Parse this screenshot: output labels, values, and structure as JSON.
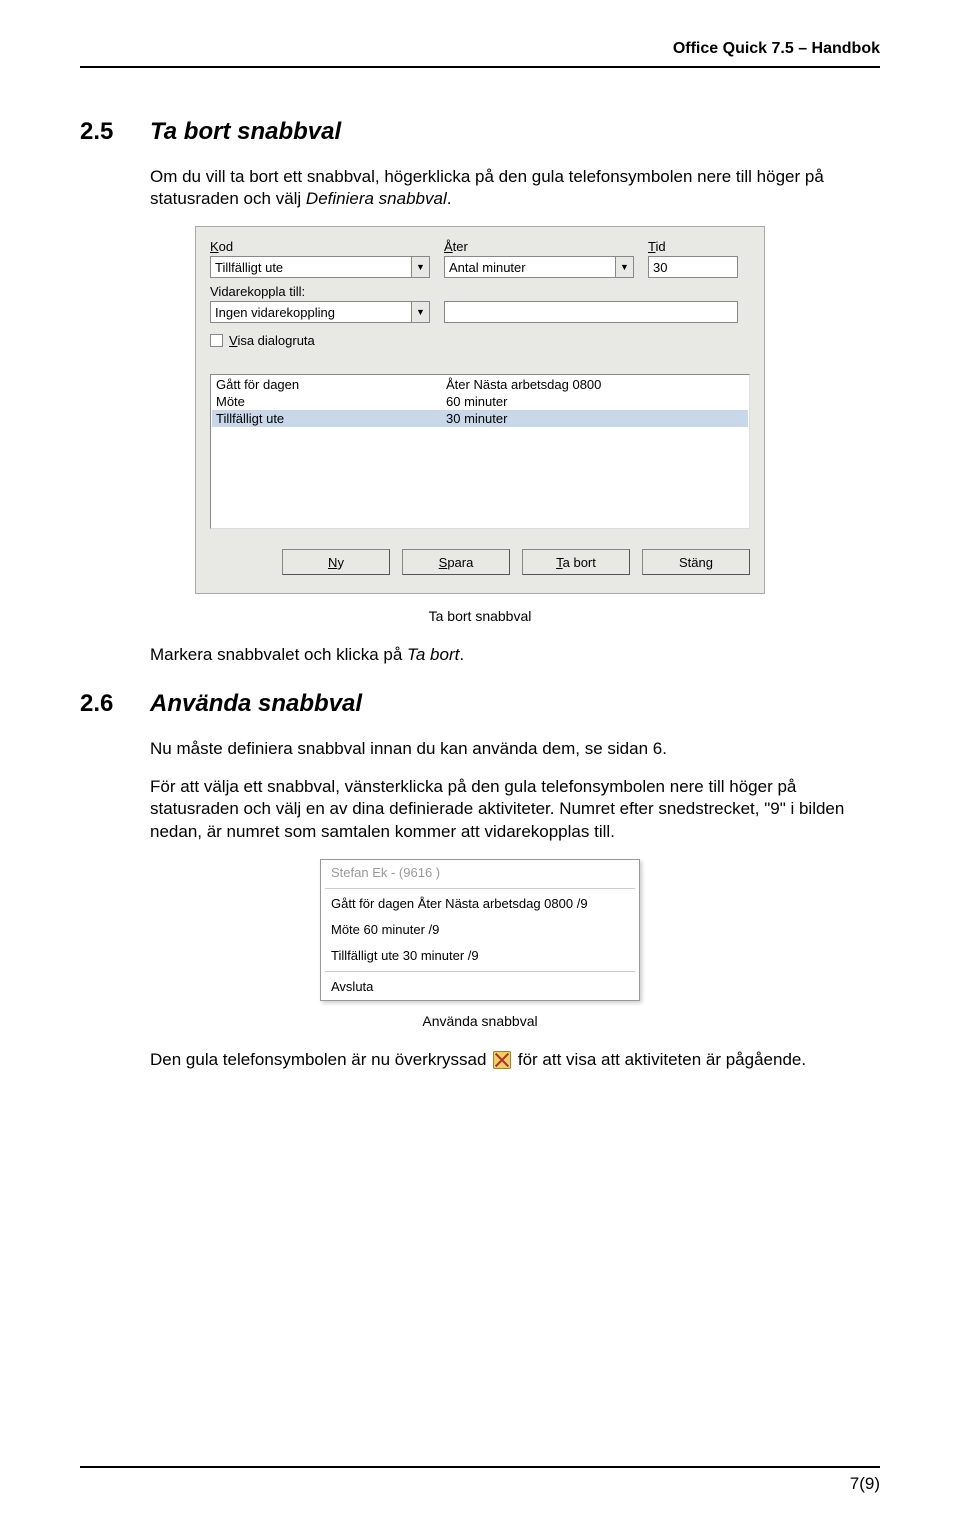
{
  "header": {
    "title": "Office Quick 7.5 – Handbok"
  },
  "section25": {
    "num": "2.5",
    "title": "Ta bort snabbval",
    "para1_a": "Om du vill ta bort ett snabbval, högerklicka på den gula telefonsymbolen nere till höger på statusraden och välj ",
    "para1_i": "Definiera snabbval",
    "para1_b": "."
  },
  "dialog": {
    "kod_label": "Kod",
    "kod_u": "K",
    "kod_value": "Tillfälligt ute",
    "ater_label": "Åter",
    "ater_u": "Å",
    "ater_value": "Antal minuter",
    "tid_label": "Tid",
    "tid_u": "T",
    "tid_value": "30",
    "vidarekoppla_label": "Vidarekoppla till:",
    "vidarekoppla_value": "Ingen vidarekoppling",
    "visa_label": "Visa dialogruta",
    "visa_u": "V",
    "list": [
      {
        "c1": "Gått för dagen",
        "c2": "Åter Nästa arbetsdag 0800",
        "sel": false
      },
      {
        "c1": "Möte",
        "c2": "60 minuter",
        "sel": false
      },
      {
        "c1": "Tillfälligt ute",
        "c2": "30 minuter",
        "sel": true
      }
    ],
    "btn_ny": "Ny",
    "btn_ny_u": "N",
    "btn_spara": "Spara",
    "btn_spara_u": "S",
    "btn_tabort": "Ta bort",
    "btn_tabort_u": "T",
    "btn_stang": "Stäng"
  },
  "caption1": "Ta bort snabbval",
  "after_dialog": {
    "text_a": "Markera snabbvalet och klicka på ",
    "text_i": "Ta bort",
    "text_b": "."
  },
  "section26": {
    "num": "2.6",
    "title": "Använda snabbval",
    "para1": "Nu måste definiera snabbval innan du kan använda dem, se sidan 6.",
    "para2": "För att välja ett snabbval, vänsterklicka på den gula telefonsymbolen nere till höger på statusraden och välj en av dina definierade aktiviteter. Numret efter snedstrecket, \"9\" i bilden nedan, är numret som samtalen kommer att vidarekopplas till."
  },
  "menu": {
    "disabled": "Stefan Ek -  (9616 )",
    "items": [
      "Gått för dagen Åter Nästa arbetsdag 0800  /9",
      "Möte 60 minuter  /9",
      "Tillfälligt ute 30 minuter  /9"
    ],
    "last": "Avsluta"
  },
  "caption2": "Använda snabbval",
  "final": {
    "a": "Den gula telefonsymbolen är nu överkryssad ",
    "b": " för att visa att aktiviteten är pågående."
  },
  "footer": "7(9)"
}
